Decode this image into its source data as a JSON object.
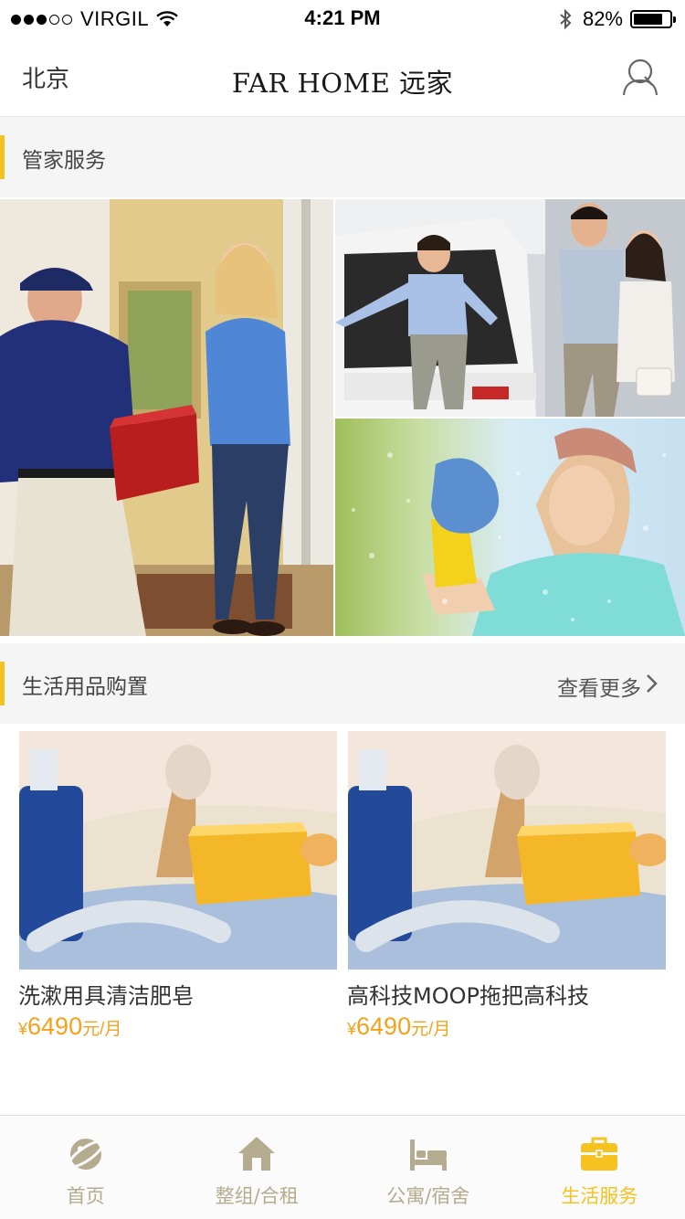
{
  "status_bar": {
    "carrier": "VIRGIL",
    "time": "4:21 PM",
    "battery_percent": "82%",
    "battery_level": 0.82
  },
  "nav": {
    "city": "北京",
    "logo": "FAR HOME 远家",
    "user_icon": "user-icon"
  },
  "butler_section": {
    "title": "管家服务",
    "photos": [
      "delivery-photo",
      "family-car-photo",
      "window-cleaning-photo"
    ]
  },
  "products_section": {
    "title": "生活用品购置",
    "more_label": "查看更多",
    "items": [
      {
        "name": "洗漱用具清洁肥皂",
        "currency": "¥",
        "price": "6490",
        "unit": "元/月"
      },
      {
        "name": "高科技MOOP拖把高科技",
        "currency": "¥",
        "price": "6490",
        "unit": "元/月"
      }
    ]
  },
  "tab_bar": {
    "tabs": [
      {
        "label": "首页",
        "icon": "planet-icon",
        "active": false
      },
      {
        "label": "整组/合租",
        "icon": "house-icon",
        "active": false
      },
      {
        "label": "公寓/宿舍",
        "icon": "bed-icon",
        "active": false
      },
      {
        "label": "生活服务",
        "icon": "briefcase-icon",
        "active": true
      }
    ]
  },
  "colors": {
    "accent": "#f5c220",
    "price": "#f2a21c",
    "tab_inactive": "#b5ab8f",
    "section_bg": "#f5f5f5"
  }
}
